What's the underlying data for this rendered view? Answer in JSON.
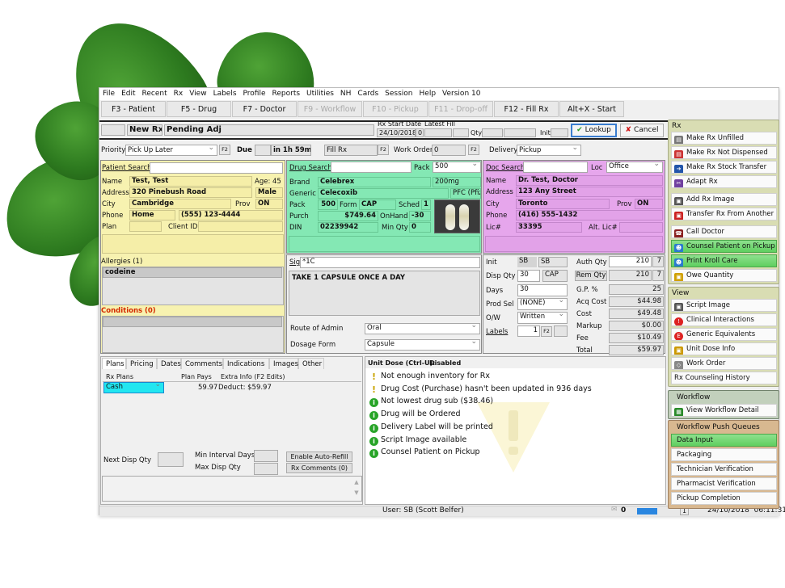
{
  "menu": [
    "File",
    "Edit",
    "Recent",
    "Rx",
    "View",
    "Labels",
    "Profile",
    "Reports",
    "Utilities",
    "NH",
    "Cards",
    "Session",
    "Help",
    "Version 10"
  ],
  "fkeys": [
    {
      "label": "F3 - Patient",
      "enabled": true
    },
    {
      "label": "F5 - Drug",
      "enabled": true
    },
    {
      "label": "F7 - Doctor",
      "enabled": true
    },
    {
      "label": "F9 - Workflow",
      "enabled": false
    },
    {
      "label": "F10 - Pickup",
      "enabled": false
    },
    {
      "label": "F11 - Drop-off",
      "enabled": false
    },
    {
      "label": "F12 - Fill Rx",
      "enabled": true
    },
    {
      "label": "Alt+X - Start",
      "enabled": true
    }
  ],
  "header": {
    "new_rx": "New Rx",
    "status": "Pending Adj",
    "rx_start_label": "Rx Start Date",
    "rx_start": "24/10/2018",
    "rx_start_num": "0",
    "latest_fill_label": "Latest Fill",
    "qty_label": "Qty",
    "init_label": "Init",
    "lookup": "Lookup",
    "cancel": "Cancel"
  },
  "row2": {
    "priority_label": "Priority",
    "priority": "Pick Up Later",
    "due_label": "Due",
    "due": "in 1h 59m",
    "fill": "Fill Rx",
    "work_order_label": "Work Order",
    "work_order": "0",
    "delivery_label": "Delivery",
    "delivery": "Pickup",
    "f2": "F2"
  },
  "patient": {
    "search_label": "Patient Search",
    "name_label": "Name",
    "name": "Test, Test",
    "age": "Age: 45",
    "address_label": "Address",
    "address": "320 Pinebush Road",
    "sex": "Male",
    "city_label": "City",
    "city": "Cambridge",
    "prov_label": "Prov",
    "prov": "ON",
    "phone_label": "Phone",
    "phone_type": "Home",
    "phone": "(555) 123-4444",
    "plan_label": "Plan",
    "client_id_label": "Client ID",
    "allergies_label": "Allergies (1)",
    "allergies": [
      "codeine"
    ],
    "conditions_label": "Conditions (0)"
  },
  "drug": {
    "search_label": "Drug Search",
    "pack_label": "Pack",
    "pack_sel": "500",
    "brand_label": "Brand",
    "brand": "Celebrex",
    "strength": "200mg",
    "generic_label": "Generic",
    "generic": "Celecoxib",
    "mfr": "PFC (Pfiz",
    "pack": "500",
    "form_label": "Form",
    "form": "CAP",
    "sched_label": "Sched",
    "sched": "1",
    "purch_label": "Purch",
    "purch": "$749.64",
    "onhand_label": "OnHand",
    "onhand": "-30",
    "din_label": "DIN",
    "din": "02239942",
    "minqty_label": "Min Qty",
    "minqty": "0"
  },
  "doctor": {
    "search_label": "Doc Search",
    "loc_label": "Loc",
    "loc": "Office",
    "name_label": "Name",
    "name": "Dr. Test, Doctor",
    "address_label": "Address",
    "address": "123 Any Street",
    "city_label": "City",
    "city": "Toronto",
    "prov_label": "Prov",
    "prov": "ON",
    "phone_label": "Phone",
    "phone": "(416) 555-1432",
    "lic_label": "Lic#",
    "lic": "33395",
    "alt_lic_label": "Alt. Lic#"
  },
  "sig": {
    "label": "Sig",
    "code": "*1C",
    "text": "TAKE 1 CAPSULE ONCE A DAY",
    "route_label": "Route of Admin",
    "route": "Oral",
    "dosage_label": "Dosage Form",
    "dosage": "Capsule"
  },
  "fill": {
    "init_label": "Init",
    "init1": "SB",
    "init2": "SB",
    "disp_label": "Disp Qty",
    "disp": "30",
    "disp_unit": "CAP",
    "days_label": "Days",
    "days": "30",
    "prodsel_label": "Prod Sel",
    "prodsel": "(NONE)",
    "ow_label": "O/W",
    "ow": "Written",
    "labels_label": "Labels",
    "labels": "1",
    "auth_label": "Auth Qty",
    "auth": "210",
    "auth_n": "7",
    "rem_label": "Rem Qty",
    "rem": "210",
    "rem_n": "7",
    "gp_label": "G.P. %",
    "gp": "25",
    "acq_label": "Acq Cost",
    "acq": "$44.98",
    "cost_label": "Cost",
    "cost": "$49.48",
    "markup_label": "Markup",
    "markup": "$0.00",
    "fee_label": "Fee",
    "fee": "$10.49",
    "total_label": "Total",
    "total": "$59.97"
  },
  "tabs": [
    "Plans",
    "Pricing",
    "Dates",
    "Comments",
    "Indications",
    "Images",
    "Other"
  ],
  "plans": {
    "col1": "Rx Plans",
    "col2": "Plan Pays",
    "col3": "Extra Info (F2 Edits)",
    "plan": "Cash",
    "pays": "59.97",
    "extra": "Deduct: $59.97",
    "next_disp_label": "Next Disp Qty",
    "min_interval_label": "Min Interval Days",
    "max_disp_label": "Max Disp Qty",
    "auto_refill": "Enable Auto-Refill",
    "rx_comments": "Rx Comments (0)"
  },
  "unit_dose": {
    "label": "Unit Dose (Ctrl-U):",
    "value": "Disabled"
  },
  "messages": [
    {
      "type": "warning",
      "text": "Not enough inventory for Rx"
    },
    {
      "type": "warning",
      "text": "Drug Cost (Purchase) hasn't been updated in 936 days"
    },
    {
      "type": "info",
      "text": "Not lowest drug sub ($38.46)"
    },
    {
      "type": "info",
      "text": "Drug will be Ordered"
    },
    {
      "type": "info",
      "text": "Delivery Label will be printed"
    },
    {
      "type": "info",
      "text": "Script Image available"
    },
    {
      "type": "info",
      "text": "Counsel Patient on Pickup"
    }
  ],
  "sidebar": {
    "rx_title": "Rx",
    "rx_items": [
      "Make Rx Unfilled",
      "Make Rx Not Dispensed",
      "Make Rx Stock Transfer",
      "Adapt Rx",
      "Add Rx Image",
      "Transfer Rx From Another ...",
      "Call Doctor",
      "Counsel Patient on Pickup",
      "Print Kroll Care",
      "Owe Quantity"
    ],
    "view_title": "View",
    "view_items": [
      "Script Image",
      "Clinical Interactions",
      "Generic Equivalents",
      "Unit Dose Info",
      "Work Order",
      "Rx Counseling History"
    ],
    "workflow_title": "Workflow",
    "workflow_item": "View Workflow Detail",
    "queues_title": "Workflow Push Queues",
    "queues": [
      "Data Input",
      "Packaging",
      "Technician Verification",
      "Pharmacist Verification",
      "Pickup Completion"
    ]
  },
  "status": {
    "user": "User: SB (Scott Belfer)",
    "mail_count": "0",
    "page": "1",
    "datetime": "24/10/2018  06:11:31"
  },
  "colors": {
    "patient": "#f5eea8",
    "drug": "#84e8b4",
    "doctor": "#e2a2e8",
    "highlight": "#5fcf5f",
    "conditions": "#d42a00"
  }
}
